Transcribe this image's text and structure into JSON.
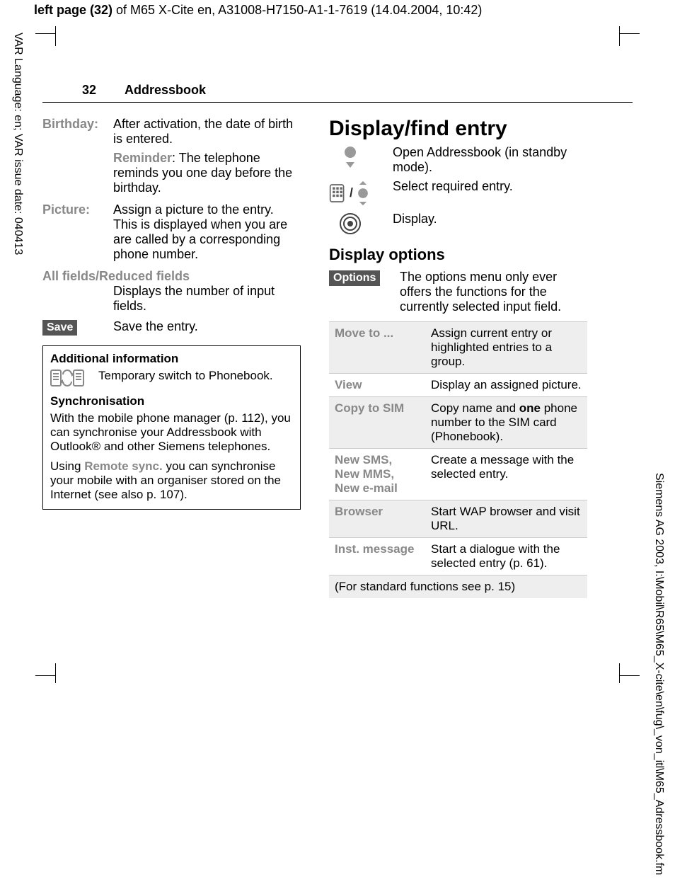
{
  "header": {
    "prefix_bold": "left page (32)",
    "rest": " of M65 X-Cite en, A31008-H7150-A1-1-7619 (14.04.2004, 10:42)"
  },
  "side_left": "VAR Language: en; VAR issue date: 040413",
  "side_right": "Siemens AG 2003, I:\\Mobil\\R65\\M65_X-cite\\en\\fug\\_von_itl\\M65_Adressbook.fm",
  "running": {
    "page_num": "32",
    "title": "Addressbook"
  },
  "left_col": {
    "birthday_label": "Birthday:",
    "birthday_text": "After activation, the date of birth is entered.",
    "reminder_label": "Reminder",
    "reminder_text": ": The telephone reminds you one day before the birthday.",
    "picture_label": "Picture:",
    "picture_text": "Assign a picture to the entry. This is displayed when you are are called by a corresponding phone number.",
    "allfields_label": "All fields/Reduced fields",
    "allfields_text": "Displays the number of input fields.",
    "save_key": "Save",
    "save_text": "Save the entry.",
    "box_title": "Additional information",
    "box_switch_text": "Temporary switch to Phonebook.",
    "sync_title": "Synchronisation",
    "sync_p1a": "With the mobile phone manager (p. 112), you can synchronise your Addressbook with Outlook® and other Siemens telephones.",
    "sync_p2_lead": "Using ",
    "sync_p2_bold": "Remote sync.",
    "sync_p2_rest": " you can synchronise your mobile with an organiser stored on the Internet (see also p. 107)."
  },
  "right_col": {
    "h1": "Display/find entry",
    "step1": "Open Addressbook (in standby mode).",
    "step2": "Select required entry.",
    "step3": "Display.",
    "h2": "Display options",
    "options_key": "Options",
    "options_text": "The options menu only ever offers the functions for the currently selected input field.",
    "table": [
      {
        "l": "Move to ...",
        "r": "Assign current entry or highlighted entries to a group."
      },
      {
        "l": "View",
        "r": "Display an assigned picture."
      },
      {
        "l": "Copy to SIM",
        "r_pre": "Copy name and ",
        "r_bold": "one",
        "r_post": " phone number to the SIM card (Phonebook)."
      },
      {
        "l": "New SMS, New MMS, New e-mail",
        "r": "Create a message with the selected entry."
      },
      {
        "l": "Browser",
        "r": "Start WAP browser and visit URL."
      },
      {
        "l": "Inst. message",
        "r": "Start a dialogue with the selected entry (p. 61)."
      }
    ],
    "table_footer": "(For standard functions see  p. 15)"
  }
}
